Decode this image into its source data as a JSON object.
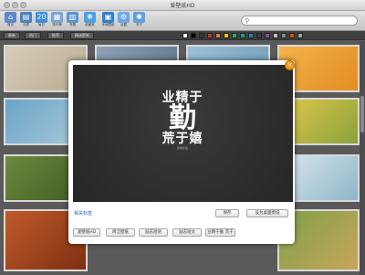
{
  "window": {
    "title": "爱壁纸HD"
  },
  "toolbar": {
    "items": [
      {
        "label": "首页",
        "icon": "home-icon",
        "color": "#5d87c7"
      },
      {
        "label": "分类",
        "icon": "category-icon",
        "color": "#4f7fbf"
      },
      {
        "label": "每日",
        "icon": "calendar-icon",
        "color": "#3a8de0",
        "glyph": "20"
      },
      {
        "label": "排行榜",
        "icon": "ranking-icon",
        "color": "#7aa5d8"
      },
      {
        "label": "专题",
        "icon": "topic-icon",
        "color": "#5b93d1"
      },
      {
        "label": "收藏夹",
        "icon": "favorites-icon",
        "color": "#4aa0e0"
      },
      {
        "label": "本地壁纸",
        "icon": "local-icon",
        "color": "#2f7fcf"
      },
      {
        "label": "设置",
        "icon": "gear-icon",
        "color": "#6aa8e8"
      },
      {
        "label": "关于",
        "icon": "about-icon",
        "color": "#5fa0dd"
      }
    ],
    "search_placeholder": ""
  },
  "filter": {
    "tabs": [
      "最新",
      "热门",
      "推荐",
      "精选壁纸"
    ],
    "swatches": [
      "#ffffff",
      "#000000",
      "#3a3a3a",
      "#c0392b",
      "#e67e22",
      "#f1c40f",
      "#27ae60",
      "#16a085",
      "#2980b9",
      "#2c3e50",
      "#8e44ad",
      "#bdc3c7",
      "#7f8c8d",
      "#d35400",
      "#95a5a6"
    ]
  },
  "modal": {
    "close_glyph": "×",
    "calligraphy": {
      "line1": "业精于",
      "line2": "勤",
      "line3": "荒于嬉",
      "small": "勤能补拙"
    },
    "related_link": "相关标签",
    "actions": {
      "save": "保存",
      "set_desktop": "设为桌面壁纸"
    },
    "tags": [
      "爱壁纸HD",
      "简洁壁纸",
      "励志短语",
      "励志短文",
      "业精于勤 荒于"
    ]
  },
  "colors": {
    "accent": "#f39a1a",
    "link": "#2a5fb5"
  }
}
